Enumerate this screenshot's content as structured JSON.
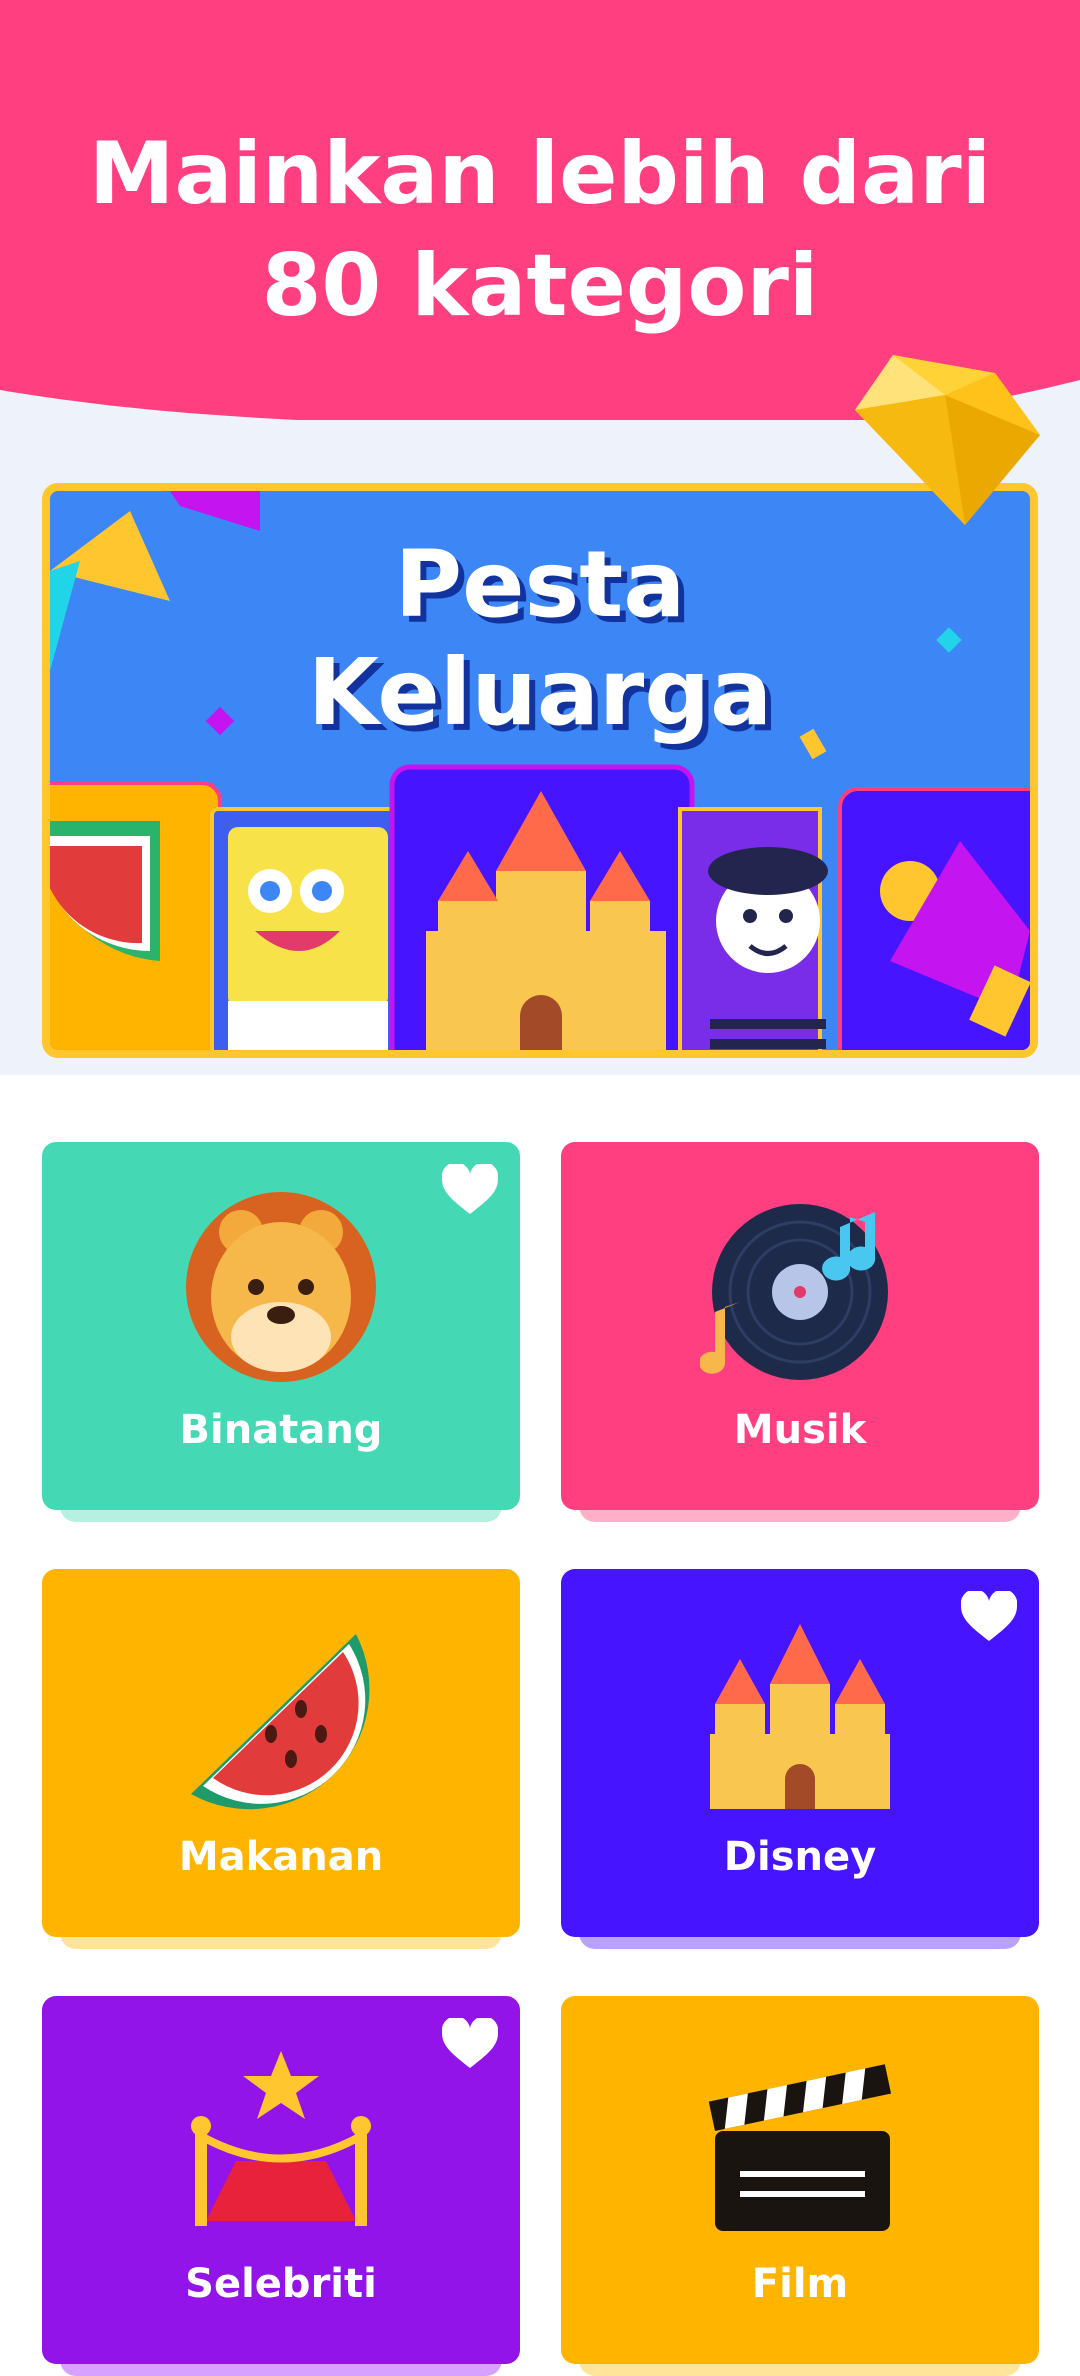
{
  "header": {
    "line1": "Mainkan lebih dari",
    "line2": "80 kategori",
    "bg_color": "#ff3f7f"
  },
  "banner": {
    "title_line1": "Pesta",
    "title_line2": "Keluarga",
    "bg_color": "#3c86f6",
    "border_color": "#ffc62f"
  },
  "categories": [
    {
      "label": "Binatang",
      "color": "#45d8b4",
      "icon": "lion-icon",
      "favorite": true
    },
    {
      "label": "Musik",
      "color": "#ff3f7f",
      "icon": "vinyl-record-icon",
      "favorite": false
    },
    {
      "label": "Makanan",
      "color": "#ffb400",
      "icon": "watermelon-icon",
      "favorite": false
    },
    {
      "label": "Disney",
      "color": "#4614ff",
      "icon": "castle-icon",
      "favorite": true
    },
    {
      "label": "Selebriti",
      "color": "#9214e8",
      "icon": "red-carpet-icon",
      "favorite": true
    },
    {
      "label": "Film",
      "color": "#ffb400",
      "icon": "clapperboard-icon",
      "favorite": false
    }
  ]
}
